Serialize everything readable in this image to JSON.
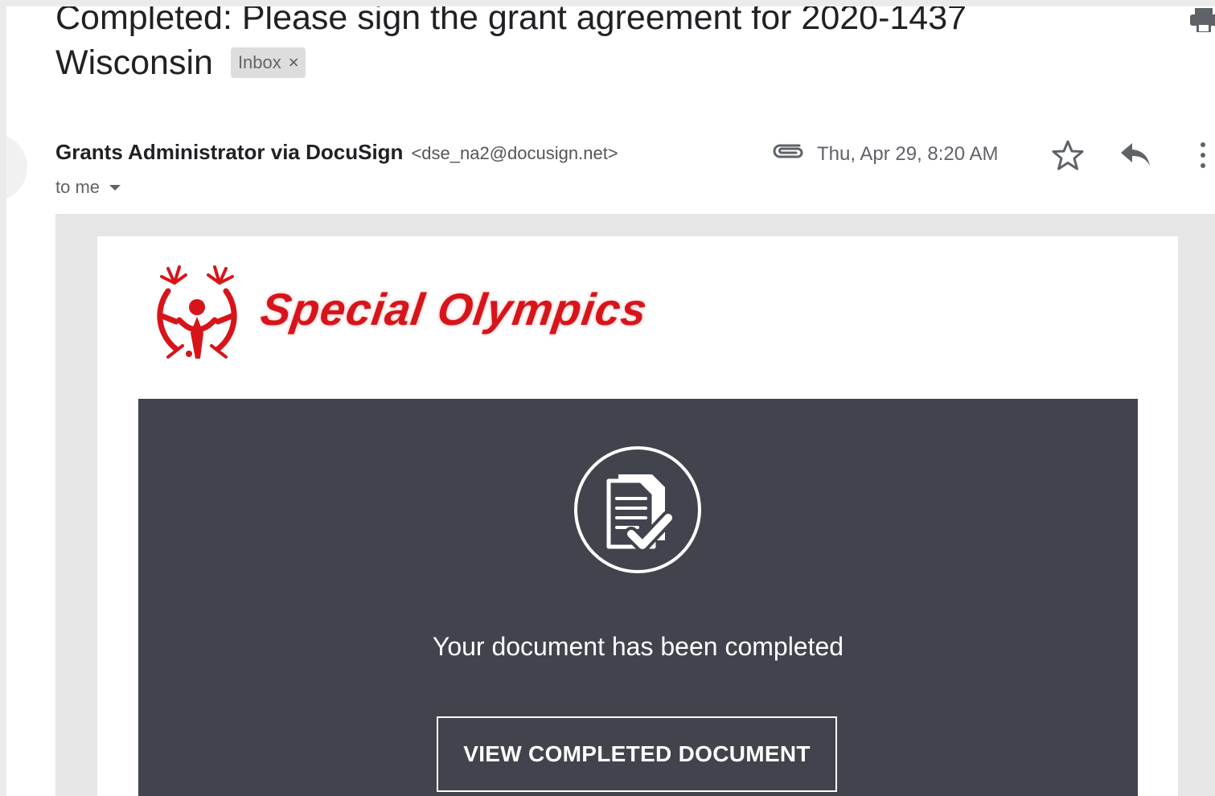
{
  "email": {
    "subject_line1": "Completed: Please sign the grant agreement for 2020-1437",
    "subject_line2": "Wisconsin",
    "label": "Inbox",
    "label_remove": "×",
    "sender_name": "Grants Administrator via DocuSign",
    "sender_email": "<dse_na2@docusign.net>",
    "recipient": "to me",
    "date": "Thu, Apr 29, 8:20 AM"
  },
  "icons": {
    "print": "print-icon",
    "attachment": "paperclip-icon",
    "star": "star-icon",
    "reply": "reply-icon",
    "more": "more-vert-icon",
    "document": "document-check-icon",
    "logo": "special-olympics-emblem-icon"
  },
  "body": {
    "brand": "Special Olympics",
    "message": "Your document has been completed",
    "button_label": "VIEW COMPLETED DOCUMENT"
  },
  "colors": {
    "brand_red": "#d7141a",
    "panel": "#41444d",
    "background": "#e6e6e6"
  }
}
